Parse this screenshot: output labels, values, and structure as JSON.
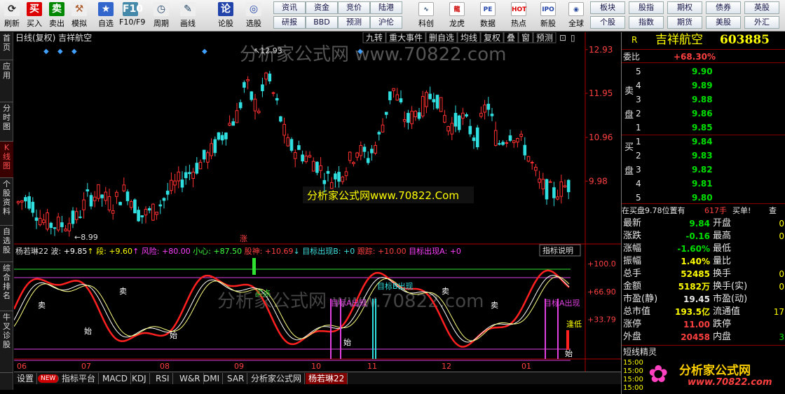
{
  "toolbar": {
    "buttons": [
      {
        "label": "刷新"
      },
      {
        "label": "买入"
      },
      {
        "label": "卖出"
      },
      {
        "label": "模拟"
      },
      {
        "label": "自选"
      },
      {
        "label": "F10/F9"
      },
      {
        "label": "周期"
      },
      {
        "label": "画线"
      },
      {
        "label": "论股"
      },
      {
        "label": "选股"
      },
      {
        "label": "研报"
      },
      {
        "label": "BBD"
      },
      {
        "label": "预测"
      },
      {
        "label": "沪伦"
      },
      {
        "label": "科创"
      },
      {
        "label": "龙虎"
      },
      {
        "label": "数据"
      },
      {
        "label": "热点"
      },
      {
        "label": "新股"
      },
      {
        "label": "全球"
      }
    ],
    "icon_glyphs": {
      "buy": "买",
      "sell": "卖",
      "f10": "F10",
      "lun": "论",
      "data": "PE",
      "new": "IPO",
      "hot": "HOT"
    },
    "top_links": [
      "资讯",
      "资金",
      "竞价",
      "陆港"
    ],
    "bottom_links": [
      "研报",
      "BBD",
      "预测",
      "沪伦"
    ],
    "right_top": [
      "板块",
      "股指",
      "期权",
      "债券",
      "英股"
    ],
    "right_bottom": [
      "个股",
      "指数",
      "期货",
      "美股",
      "外汇"
    ]
  },
  "leftnav": [
    "首页",
    "应用",
    "分时图",
    "K线图",
    "个股资料",
    "自选股",
    "综合排名",
    "牛叉诊股"
  ],
  "chart": {
    "header_left": "日线(复权)  吉祥航空",
    "header_buttons": [
      "九转",
      "重大事件",
      "删自选",
      "均线",
      "复权",
      "叠",
      "窗",
      "预测"
    ],
    "price_labels": [
      "12.93",
      "11.95",
      "10.96",
      "9.98"
    ],
    "high_mark": "12.93",
    "low_mark": "8.99",
    "zhang_mark": "涨",
    "watermark_mid": "分析家公式网www.70822.Com",
    "watermark_top": "分析家公式网 www.70822.com",
    "watermark_ind": "分析家公式网 www.70822.com",
    "indicator_header": [
      {
        "t": "杨若琳22 波: ",
        "c": "#e0e0e0"
      },
      {
        "t": "+9.85",
        "c": "#ffffff"
      },
      {
        "t": "↑ 段: ",
        "c": "#ffff00"
      },
      {
        "t": "+9.60",
        "c": "#ffff00"
      },
      {
        "t": "↑ 风险: ",
        "c": "#ff40ff"
      },
      {
        "t": "+80.00",
        "c": "#ff40ff"
      },
      {
        "t": " 小心: ",
        "c": "#40ff40"
      },
      {
        "t": "+87.50",
        "c": "#40ff40"
      },
      {
        "t": " 股神: ",
        "c": "#ff4040"
      },
      {
        "t": "+10.69",
        "c": "#ff4040"
      },
      {
        "t": "↓ 目标出现B: ",
        "c": "#40e0e0"
      },
      {
        "t": "+0",
        "c": "#40e0e0"
      },
      {
        "t": " 跟踪: ",
        "c": "#ff4040"
      },
      {
        "t": "+10.00",
        "c": "#ff4040"
      },
      {
        "t": " 目标出现A: ",
        "c": "#ff40ff"
      },
      {
        "t": "+0",
        "c": "#ff40ff"
      }
    ],
    "indicator_help": "指标说明",
    "ind_axis": [
      "+100.0",
      "+66.90",
      "+33.79"
    ],
    "date_labels": [
      "06",
      "07",
      "08",
      "09",
      "10",
      "11",
      "12",
      "01"
    ],
    "annotations": {
      "sell": "卖",
      "bottom": "始",
      "buy": "买点",
      "target_a": "目标A出现",
      "target_b": "目标B出现",
      "low_buy": "逢低",
      "target_ab": "目标A出现"
    }
  },
  "tabs": [
    "设置",
    "NEW",
    "指标平台",
    "MACD",
    "KDJ",
    "RSI",
    "W&R",
    "DMI",
    "SAR",
    "分析家公式网",
    "杨若琳22"
  ],
  "quote": {
    "R": "R",
    "name": "吉祥航空",
    "code": "603885",
    "weibi_label": "委比",
    "weibi": "+68.30%",
    "sell_label": "卖盘",
    "buy_label": "买盘",
    "sell": [
      {
        "n": "5",
        "p": "9.90"
      },
      {
        "n": "4",
        "p": "9.89"
      },
      {
        "n": "3",
        "p": "9.88"
      },
      {
        "n": "2",
        "p": "9.86"
      },
      {
        "n": "1",
        "p": "9.85"
      }
    ],
    "buy": [
      {
        "n": "1",
        "p": "9.84"
      },
      {
        "n": "2",
        "p": "9.83"
      },
      {
        "n": "3",
        "p": "9.82"
      },
      {
        "n": "4",
        "p": "9.81"
      },
      {
        "n": "5",
        "p": "9.80"
      }
    ],
    "pos_text": "在买盘9.78位置有",
    "pos_vol": "617手",
    "pos_tag": "买单!",
    "pos_query": "查",
    "stats": [
      {
        "l": "最新",
        "v": "9.84",
        "c": "gr",
        "r": "开盘"
      },
      {
        "l": "涨跌",
        "v": "-0.16",
        "c": "gr",
        "r": "最高"
      },
      {
        "l": "涨幅",
        "v": "-1.60%",
        "c": "gr",
        "r": "最低"
      },
      {
        "l": "振幅",
        "v": "1.40%",
        "c": "cy",
        "r": "量比"
      },
      {
        "l": "总手",
        "v": "52485",
        "c": "cy",
        "r": "换手"
      },
      {
        "l": "金额",
        "v": "5182万",
        "c": "cy",
        "r": "换手(实)"
      },
      {
        "l": "市盈(静)",
        "v": "19.45",
        "c": "wh",
        "r": "市盈(动)"
      },
      {
        "l": "总市值",
        "v": "193.5亿",
        "c": "cy",
        "r": "流通值"
      },
      {
        "l": "涨停",
        "v": "11.00",
        "c": "rd",
        "r": "跌停"
      },
      {
        "l": "外盘",
        "v": "20458",
        "c": "rd",
        "r": "内盘"
      }
    ],
    "stats_right_vals": [
      "0",
      "0",
      "",
      "",
      "0",
      "0",
      "",
      "17",
      "",
      "3"
    ],
    "elf_title": "短线精灵",
    "elf_rows": [
      "15:00",
      "15:00",
      "15:00",
      "15:00"
    ],
    "logo_text": "分析家公式网",
    "logo_url": "www.70822.com"
  }
}
